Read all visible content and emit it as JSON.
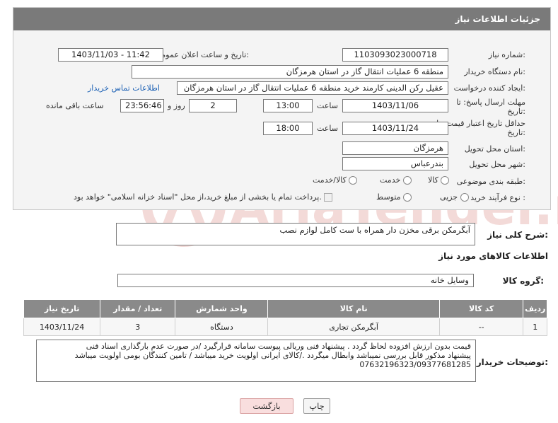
{
  "header": {
    "title": "جزئیات اطلاعات نیاز"
  },
  "fields": {
    "need_number_label": "شماره نیاز:",
    "need_number": "1103093023000718",
    "announce_label": "تاریخ و ساعت اعلان عمومی:",
    "announce_value": "1403/11/03 - 11:42",
    "buyer_org_label": "نام دستگاه خریدار:",
    "buyer_org": "منطقه 6 عملیات انتقال گاز در استان هرمزگان",
    "requester_label": "ایجاد کننده درخواست:",
    "requester": "عقیل رکن الدینی کارمند خرید منطقه 6 عملیات انتقال گاز در استان هرمزگان",
    "contact_link": "اطلاعات تماس خریدار",
    "deadline_label_1": "مهلت ارسال پاسخ: تا",
    "deadline_label_2": "تاریخ:",
    "deadline_date": "1403/11/06",
    "time_label": "ساعت",
    "deadline_time": "13:00",
    "days_value": "2",
    "days_label": "روز و",
    "remaining_time": "23:56:46",
    "remaining_label": "ساعت باقی مانده",
    "validity_label_1": "حداقل تاریخ اعتبار قیمت: تا",
    "validity_label_2": "تاریخ:",
    "validity_date": "1403/11/24",
    "validity_time_label": "ساعت",
    "validity_time": "18:00",
    "province_label": "استان محل تحویل:",
    "province": "هرمزگان",
    "city_label": "شهر محل تحویل:",
    "city": "بندرعباس",
    "category_label": "طبقه بندی موضوعی:",
    "category_options": [
      "کالا",
      "خدمت",
      "کالا/خدمت"
    ],
    "process_label": "نوع فرآیند خرید :",
    "process_options": [
      "جزیی",
      "متوسط"
    ],
    "payment_note": "پرداخت تمام یا بخشی از مبلغ خرید،از محل \"اسناد خزانه اسلامی\" خواهد بود."
  },
  "summary": {
    "label": "شرح کلی نیاز:",
    "value": "آبگرمکن برقی مخزن دار همراه با ست کامل لوازم نصب"
  },
  "goods_section": {
    "title": "اطلاعات کالاهای مورد نیاز",
    "group_label": "گروه کالا:",
    "group_value": "وسایل خانه"
  },
  "table": {
    "headers": [
      "ردیف",
      "کد کالا",
      "نام کالا",
      "واحد شمارش",
      "تعداد / مقدار",
      "تاریخ نیاز"
    ],
    "rows": [
      [
        "1",
        "--",
        "آبگرمکن تجاری",
        "دستگاه",
        "3",
        "1403/11/24"
      ]
    ]
  },
  "buyer_notes": {
    "label": "توضیحات خریدار:",
    "line1": "قیمت بدون ارزش افزوده لحاظ گردد . پیشنهاد فنی وریالی پیوست سامانه قرارگیرد /در صورت عدم بارگذاری اسناد فنی",
    "line2": "پیشنهاد مذکور قابل بررسی نمیباشد وابطال میگردد ./کالای ایرانی اولویت خرید میباشد / تامین کنندگان بومی اولویت میباشد",
    "line3": "07632196323/09377681285"
  },
  "buttons": {
    "print": "چاپ",
    "back": "بازگشت"
  },
  "watermark_text": "AriaTender.net",
  "colors": {
    "header_bg": "#7a7a7a",
    "link": "#1a5fb4",
    "back_btn_bg": "#f9dede"
  }
}
